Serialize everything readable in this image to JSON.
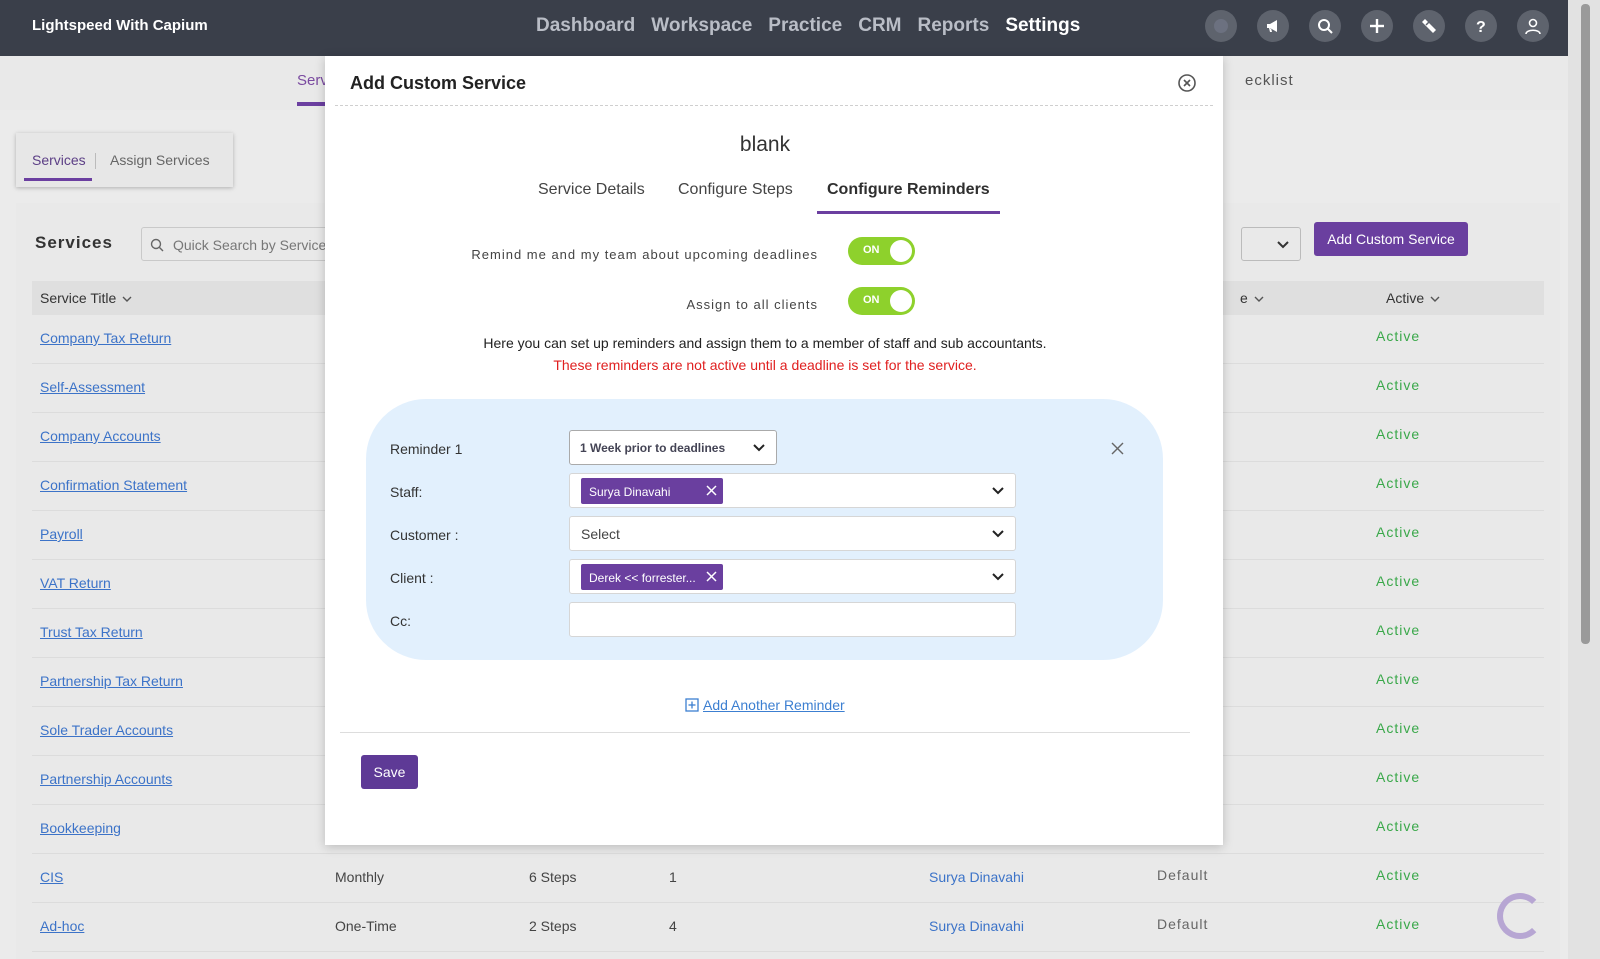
{
  "app": {
    "brand": "Lightspeed With Capium"
  },
  "nav": {
    "items": [
      "Dashboard",
      "Workspace",
      "Practice",
      "CRM",
      "Reports",
      "Settings"
    ],
    "active": "Settings"
  },
  "subtabs": {
    "left_partial": "Serv",
    "right_partial": "ecklist"
  },
  "segmented": {
    "services": "Services",
    "assign": "Assign Services"
  },
  "services": {
    "title": "Services",
    "search_placeholder": "Quick Search by Service",
    "add_button": "Add Custom Service",
    "col_title": "Service Title",
    "col_e_partial": "e",
    "col_active": "Active",
    "rows": [
      {
        "title": "Company Tax Return",
        "freq": "",
        "steps": "",
        "num": "",
        "owner": "",
        "def": "",
        "status": "Active"
      },
      {
        "title": "Self-Assessment",
        "freq": "",
        "steps": "",
        "num": "",
        "owner": "",
        "def": "",
        "status": "Active"
      },
      {
        "title": "Company Accounts",
        "freq": "",
        "steps": "",
        "num": "",
        "owner": "",
        "def": "",
        "status": "Active"
      },
      {
        "title": "Confirmation Statement",
        "freq": "",
        "steps": "",
        "num": "",
        "owner": "",
        "def": "",
        "status": "Active"
      },
      {
        "title": "Payroll",
        "freq": "",
        "steps": "",
        "num": "",
        "owner": "",
        "def": "",
        "status": "Active"
      },
      {
        "title": "VAT Return",
        "freq": "",
        "steps": "",
        "num": "",
        "owner": "",
        "def": "",
        "status": "Active"
      },
      {
        "title": "Trust Tax Return",
        "freq": "",
        "steps": "",
        "num": "",
        "owner": "",
        "def": "",
        "status": "Active"
      },
      {
        "title": "Partnership Tax Return",
        "freq": "",
        "steps": "",
        "num": "",
        "owner": "",
        "def": "",
        "status": "Active"
      },
      {
        "title": "Sole Trader Accounts",
        "freq": "",
        "steps": "",
        "num": "",
        "owner": "",
        "def": "",
        "status": "Active"
      },
      {
        "title": "Partnership Accounts",
        "freq": "",
        "steps": "",
        "num": "",
        "owner": "",
        "def": "",
        "status": "Active"
      },
      {
        "title": "Bookkeeping",
        "freq": "",
        "steps": "",
        "num": "",
        "owner": "",
        "def": "",
        "status": "Active"
      },
      {
        "title": "CIS",
        "freq": "Monthly",
        "steps": "6 Steps",
        "num": "1",
        "owner": "Surya Dinavahi",
        "def": "Default",
        "status": "Active"
      },
      {
        "title": "Ad-hoc",
        "freq": "One-Time",
        "steps": "2 Steps",
        "num": "4",
        "owner": "Surya Dinavahi",
        "def": "Default",
        "status": "Active"
      }
    ]
  },
  "modal": {
    "title": "Add Custom Service",
    "service_name": "blank",
    "tabs": [
      "Service Details",
      "Configure Steps",
      "Configure Reminders"
    ],
    "active_tab": "Configure Reminders",
    "toggle1_label": "Remind me and my team about upcoming deadlines",
    "toggle1_state": "ON",
    "toggle2_label": "Assign to all clients",
    "toggle2_state": "ON",
    "info_text": "Here you can set up reminders and assign them to a member of staff and sub accountants.",
    "warning_text": "These reminders are not active until a deadline is set for the service.",
    "reminder": {
      "label": "Reminder 1",
      "period": "1 Week prior to deadlines",
      "staff_label": "Staff:",
      "staff_chip": "Surya Dinavahi",
      "customer_label": "Customer :",
      "customer_placeholder": "Select",
      "client_label": "Client :",
      "client_chip": "Derek << forrester...",
      "cc_label": "Cc:",
      "cc_value": ""
    },
    "add_reminder": "Add Another Reminder",
    "save": "Save"
  }
}
